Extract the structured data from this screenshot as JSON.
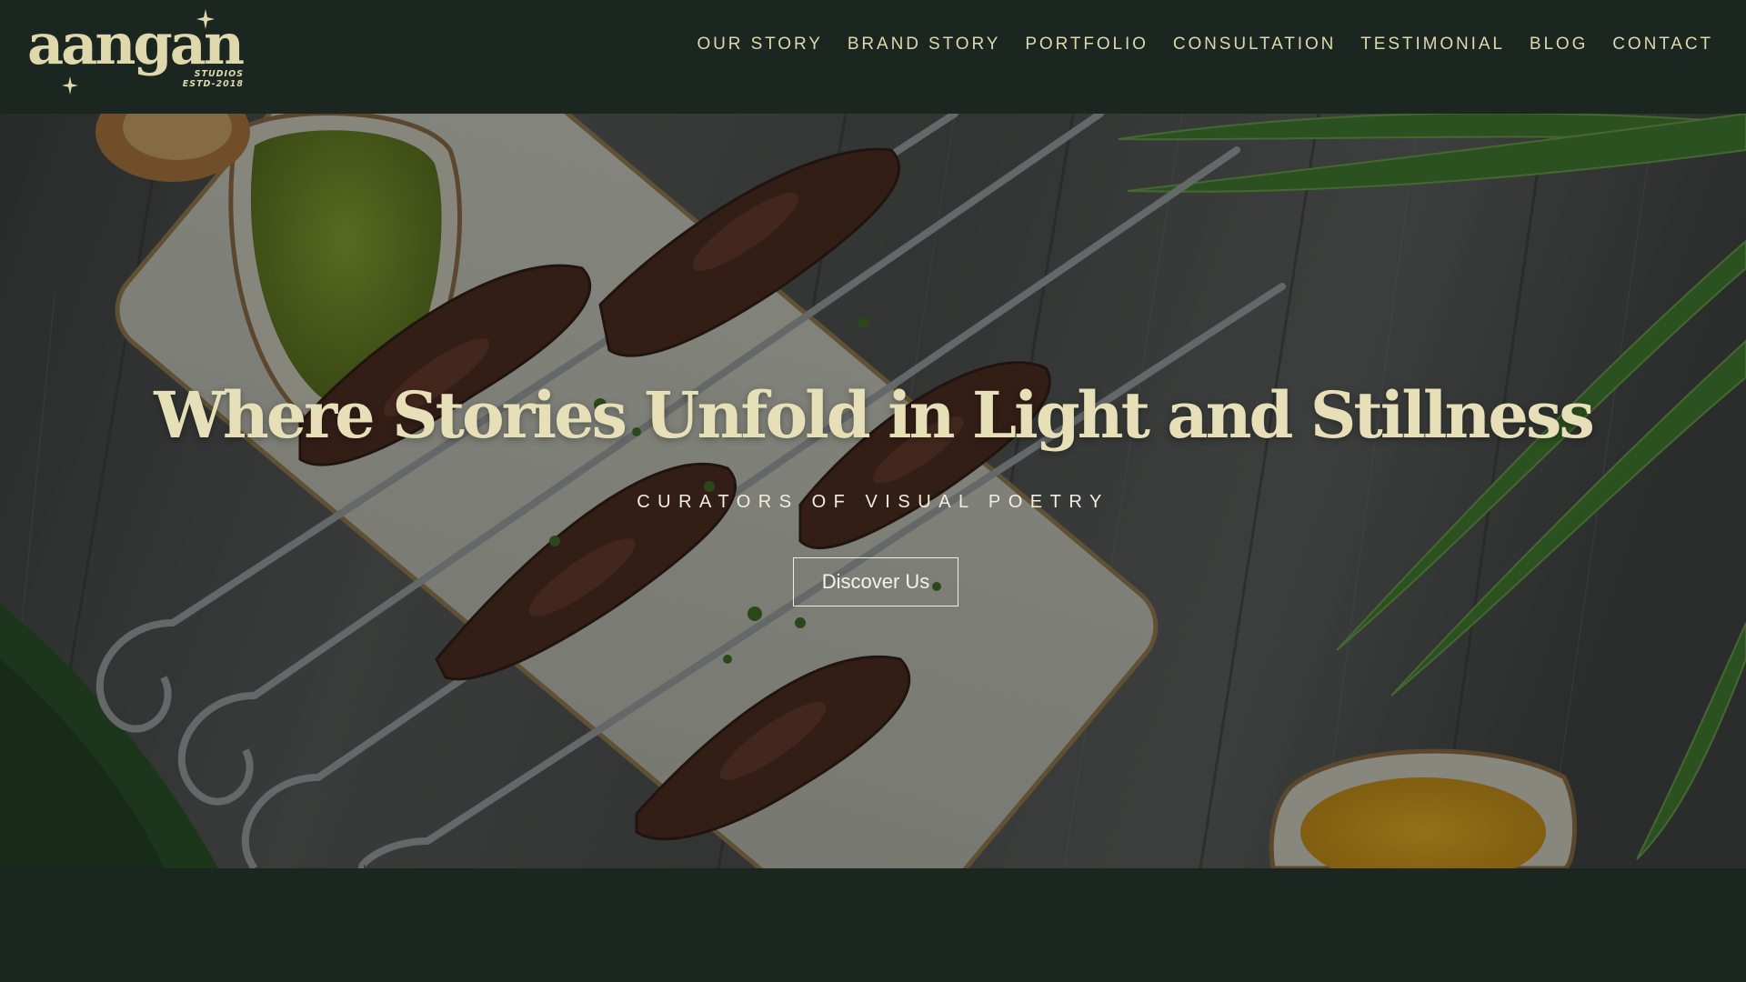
{
  "brand": {
    "logo_word": "aangan",
    "logo_sub_line1": "STUDIOS",
    "logo_sub_line2": "ESTD-2018"
  },
  "nav": {
    "items": [
      {
        "label": "OUR STORY"
      },
      {
        "label": "BRAND STORY"
      },
      {
        "label": "PORTFOLIO"
      },
      {
        "label": "CONSULTATION"
      },
      {
        "label": "TESTIMONIAL"
      },
      {
        "label": "BLOG"
      },
      {
        "label": "CONTACT"
      }
    ]
  },
  "hero": {
    "title": "Where Stories Unfold in Light and Stillness",
    "subtitle": "CURATORS OF VISUAL POETRY",
    "button_label": "Discover Us"
  },
  "colors": {
    "background": "#1b2620",
    "accent_cream": "#e0d8ad",
    "button_border": "#f2efe0"
  },
  "icons": [
    "sparkle-star-icon"
  ]
}
